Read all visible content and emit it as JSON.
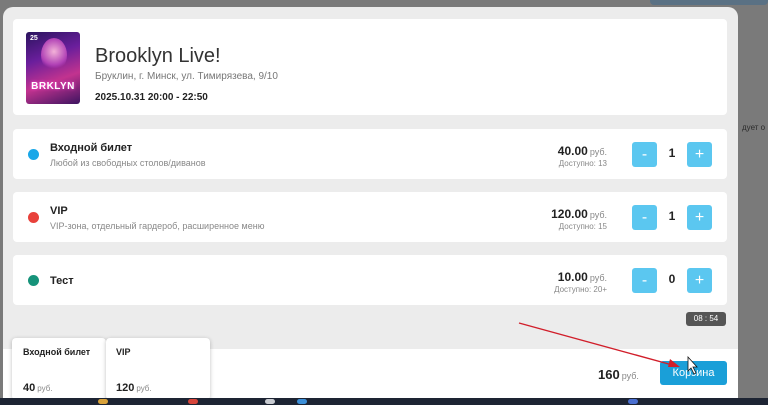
{
  "background": {
    "side_text": "дует о"
  },
  "event": {
    "poster_text": "BRKLYN",
    "poster_date": "25",
    "title": "Brooklyn Live!",
    "address": "Бруклин, г. Минск, ул. Тимирязева, 9/10",
    "datetime": "2025.10.31 20:00 - 22:50"
  },
  "tickets": [
    {
      "name": "Входной билет",
      "description": "Любой из свободных столов/диванов",
      "price": "40.00",
      "currency": "руб.",
      "available": "Доступно: 13",
      "quantity": "1",
      "color": "#1aa7e8"
    },
    {
      "name": "VIP",
      "description": "VIP-зона, отдельный гардероб, расширенное меню",
      "price": "120.00",
      "currency": "руб.",
      "available": "Доступно: 15",
      "quantity": "1",
      "color": "#e8413b"
    },
    {
      "name": "Тест",
      "description": "",
      "price": "10.00",
      "currency": "руб.",
      "available": "Доступно: 20+",
      "quantity": "0",
      "color": "#16937a"
    }
  ],
  "controls": {
    "minus": "-",
    "plus": "+"
  },
  "timer": "08 : 54",
  "footer": {
    "total": "160",
    "currency": "руб.",
    "cart_label": "Корзина"
  },
  "summary": [
    {
      "name": "Входной билет",
      "price": "40",
      "currency": "руб."
    },
    {
      "name": "VIP",
      "price": "120",
      "currency": "руб."
    }
  ]
}
